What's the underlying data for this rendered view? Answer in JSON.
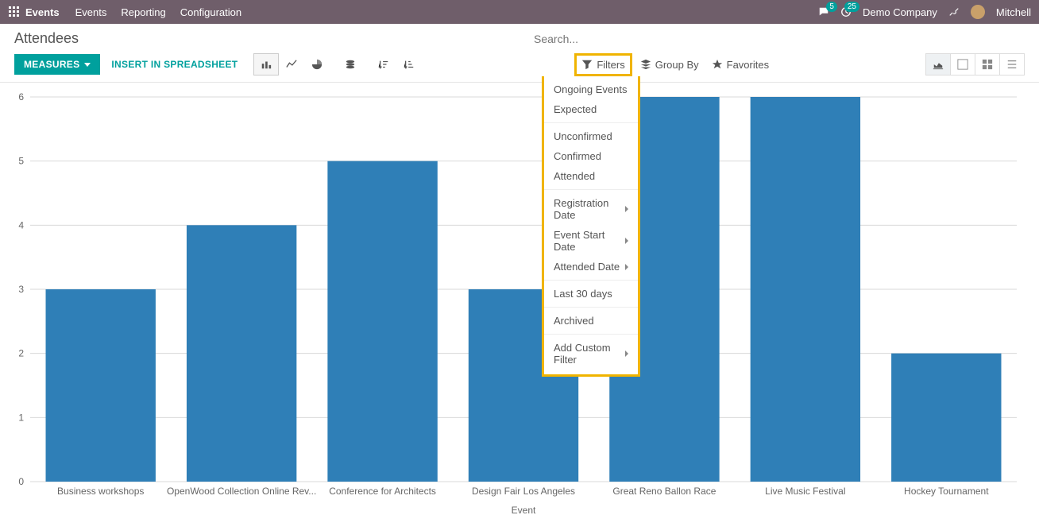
{
  "nav": {
    "brand": "Events",
    "links": [
      "Events",
      "Reporting",
      "Configuration"
    ],
    "messages_badge": "5",
    "activities_badge": "25",
    "company": "Demo Company",
    "user": "Mitchell"
  },
  "header": {
    "title": "Attendees",
    "search_placeholder": "Search..."
  },
  "toolbar": {
    "measures_label": "MEASURES",
    "insert_label": "INSERT IN SPREADSHEET",
    "filters_label": "Filters",
    "groupby_label": "Group By",
    "favorites_label": "Favorites"
  },
  "filters_dropdown": {
    "group1": [
      "Ongoing Events",
      "Expected"
    ],
    "group2": [
      "Unconfirmed",
      "Confirmed",
      "Attended"
    ],
    "group3": [
      {
        "label": "Registration Date",
        "submenu": true
      },
      {
        "label": "Event Start Date",
        "submenu": true
      },
      {
        "label": "Attended Date",
        "submenu": true
      }
    ],
    "group4": [
      "Last 30 days"
    ],
    "group5": [
      "Archived"
    ],
    "group6": [
      {
        "label": "Add Custom Filter",
        "submenu": true
      }
    ]
  },
  "chart_data": {
    "type": "bar",
    "categories": [
      "Business workshops",
      "OpenWood Collection Online Rev...",
      "Conference for Architects",
      "Design Fair Los Angeles",
      "Great Reno Ballon Race",
      "Live Music Festival",
      "Hockey Tournament"
    ],
    "values": [
      3,
      4,
      5,
      3,
      6,
      6,
      2
    ],
    "xlabel": "Event",
    "ylabel": "",
    "ylim": [
      0,
      6
    ],
    "yticks": [
      0,
      1,
      2,
      3,
      4,
      5,
      6
    ],
    "bar_color": "#2f7fb7"
  }
}
